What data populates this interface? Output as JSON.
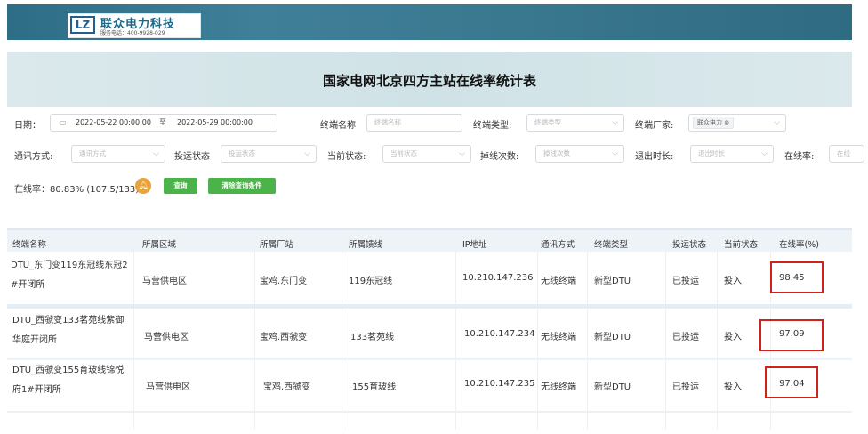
{
  "header": {
    "logo_mark": "LZ",
    "company_name": "联众电力科技",
    "service_tel": "服务电话：400-9928-029",
    "page_title": "国家电网北京四方主站在线率统计表"
  },
  "filters": {
    "date_label": "日期：",
    "date_start": "2022-05-22 00:00:00",
    "date_sep": "至",
    "date_end": "2022-05-29 00:00:00",
    "terminal_name_label": "终端名称",
    "terminal_name_placeholder": "终端名称",
    "terminal_type_label": "终端类型:",
    "terminal_type_placeholder": "终端类型",
    "vendor_label": "终端厂家:",
    "vendor_tag": "联众电力",
    "comm_label": "通讯方式:",
    "comm_placeholder": "通讯方式",
    "op_status_label": "投运状态",
    "op_status_placeholder": "投运状态",
    "current_status_label": "当前状态:",
    "current_status_placeholder": "当前状态",
    "drop_count_label": "掉线次数:",
    "drop_count_placeholder": "掉线次数",
    "exit_time_label": "退出时长:",
    "exit_time_placeholder": "退出时长",
    "online_rate_label": "在线率:",
    "online_rate_placeholder": "在线"
  },
  "summary": {
    "text": "在线率：80.83% (107.5/133)",
    "query_button": "查询",
    "clear_button": "清除查询条件"
  },
  "table": {
    "columns": [
      "终端名称",
      "所属区域",
      "所属厂站",
      "所属馈线",
      "IP地址",
      "通讯方式",
      "终端类型",
      "投运状态",
      "当前状态",
      "在线率(%)"
    ],
    "rows": [
      {
        "name_line1": "DTU_东门变119东冠线东冠2",
        "name_line2": "#开闭所",
        "area": "马营供电区",
        "station": "宝鸡.东门变",
        "feeder": "119东冠线",
        "ip": "10.210.147.236",
        "comm": "无线终端",
        "type": "新型DTU",
        "op": "已投运",
        "status": "投入",
        "rate": "98.45"
      },
      {
        "name_line1": "DTU_西虢变133茗苑线紫御",
        "name_line2": "华庭开闭所",
        "area": "马营供电区",
        "station": "宝鸡.西虢变",
        "feeder": "133茗苑线",
        "ip": "10.210.147.234",
        "comm": "无线终端",
        "type": "新型DTU",
        "op": "已投运",
        "status": "投入",
        "rate": "97.09"
      },
      {
        "name_line1": "DTU_西虢变155育玻线锦悦",
        "name_line2": "府1#开闭所",
        "area": "马营供电区",
        "station": "宝鸡.西虢变",
        "feeder": "155育玻线",
        "ip": "10.210.147.235",
        "comm": "无线终端",
        "type": "新型DTU",
        "op": "已投运",
        "status": "投入",
        "rate": "97.04"
      }
    ]
  }
}
